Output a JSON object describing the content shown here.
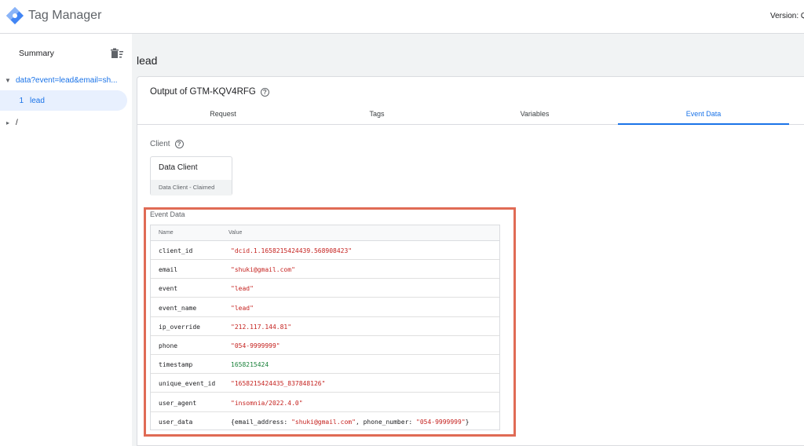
{
  "app": {
    "title": "Tag Manager",
    "version_label": "Version: Q"
  },
  "sidebar": {
    "summary_label": "Summary",
    "items": [
      {
        "label": "data?event=lead&email=sh..."
      },
      {
        "index": "1",
        "label": "lead"
      },
      {
        "label": "/"
      }
    ]
  },
  "main": {
    "page_title": "lead",
    "output_title": "Output of GTM-KQV4RFG",
    "tabs": [
      {
        "label": "Request"
      },
      {
        "label": "Tags"
      },
      {
        "label": "Variables"
      },
      {
        "label": "Event Data"
      }
    ],
    "client": {
      "section_label": "Client",
      "name": "Data Client",
      "status": "Data Client - Claimed"
    },
    "event_data": {
      "section_label": "Event Data",
      "columns": [
        "Name",
        "Value"
      ],
      "rows": [
        {
          "name": "client_id",
          "value": "\"dcid.1.1658215424439.568908423\"",
          "kind": "str"
        },
        {
          "name": "email",
          "value": "\"shuki@gmail.com\"",
          "kind": "str"
        },
        {
          "name": "event",
          "value": "\"lead\"",
          "kind": "str"
        },
        {
          "name": "event_name",
          "value": "\"lead\"",
          "kind": "str"
        },
        {
          "name": "ip_override",
          "value": "\"212.117.144.81\"",
          "kind": "str"
        },
        {
          "name": "phone",
          "value": "\"054-9999999\"",
          "kind": "str"
        },
        {
          "name": "timestamp",
          "value": "1658215424",
          "kind": "num"
        },
        {
          "name": "unique_event_id",
          "value": "\"1658215424435_837848126\"",
          "kind": "str"
        },
        {
          "name": "user_agent",
          "value": "\"insomnia/2022.4.0\"",
          "kind": "str"
        },
        {
          "name": "user_data",
          "kind": "obj",
          "parts": [
            {
              "text": "{email_address: ",
              "kind": "obj"
            },
            {
              "text": "\"shuki@gmail.com\"",
              "kind": "str"
            },
            {
              "text": ", phone_number: ",
              "kind": "obj"
            },
            {
              "text": "\"054-9999999\"",
              "kind": "str"
            },
            {
              "text": "}",
              "kind": "obj"
            }
          ]
        }
      ]
    }
  },
  "colors": {
    "accent": "#1a73e8",
    "highlight_border": "#e06b55",
    "string_value": "#c5221f",
    "number_value": "#188038"
  },
  "icons": [
    "tag-manager-logo-icon",
    "delete-sweep-icon",
    "help-icon",
    "caret-down-icon",
    "caret-right-icon"
  ]
}
